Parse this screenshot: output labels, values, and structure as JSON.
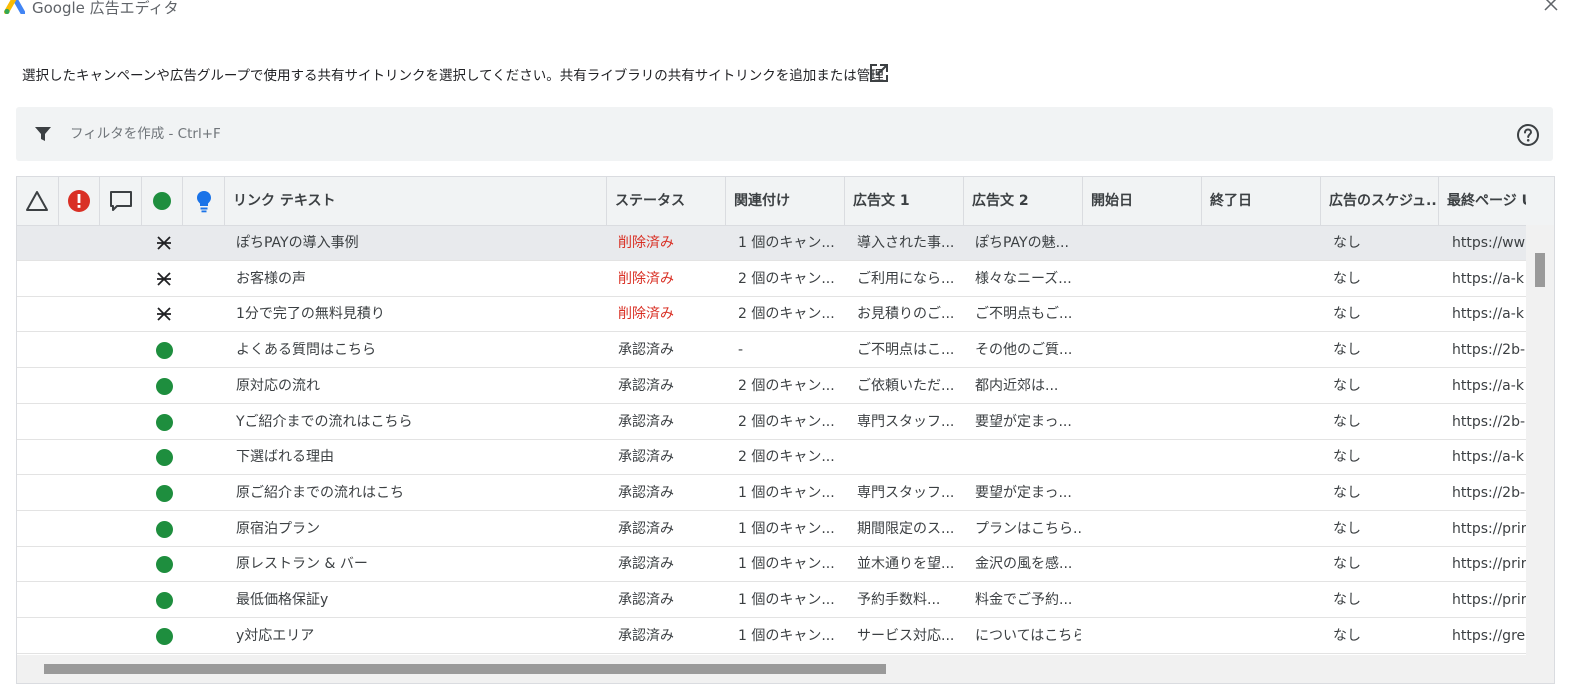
{
  "app_title": "Google 広告エディタ",
  "instruction": "選択したキャンペーンや広告グループで使用する共有サイトリンクを選択してください。共有ライブラリの共有サイトリンクを追加または管理",
  "filter": {
    "placeholder": "フィルタを作成 - Ctrl+F"
  },
  "colors": {
    "green": "#1e8e3e",
    "red": "#d93025",
    "blue": "#1a73e8",
    "error_red": "#d93025"
  },
  "header_icons": [
    "warning-triangle-icon",
    "error-icon",
    "comment-icon",
    "status-dot-icon",
    "lightbulb-icon"
  ],
  "columns": {
    "link_text": "リンク テキスト",
    "status": "ステータス",
    "association": "関連付け",
    "desc1": "広告文 1",
    "desc2": "広告文 2",
    "start": "開始日",
    "end": "終了日",
    "schedule": "広告のスケジュ...",
    "final_url": "最終ページ U"
  },
  "rows": [
    {
      "state": "deleted",
      "link_text": "ぽちPAYの導入事例",
      "status": "削除済み",
      "association": "1 個のキャン...",
      "desc1": "導入された事...",
      "desc2": "ぽちPAYの魅...",
      "start": "",
      "end": "",
      "schedule": "なし",
      "final_url": "https://ww"
    },
    {
      "state": "deleted",
      "link_text": "お客様の声",
      "status": "削除済み",
      "association": "2 個のキャン...",
      "desc1": "ご利用になら...",
      "desc2": "様々なニーズ...",
      "start": "",
      "end": "",
      "schedule": "なし",
      "final_url": "https://a-k"
    },
    {
      "state": "deleted",
      "link_text": "1分で完了の無料見積り",
      "status": "削除済み",
      "association": "2 個のキャン...",
      "desc1": "お見積りのご...",
      "desc2": "ご不明点もご...",
      "start": "",
      "end": "",
      "schedule": "なし",
      "final_url": "https://a-k"
    },
    {
      "state": "approved",
      "link_text": "よくある質問はこちら",
      "status": "承認済み",
      "association": "-",
      "desc1": "ご不明点はこ...",
      "desc2": "その他のご質...",
      "start": "",
      "end": "",
      "schedule": "なし",
      "final_url": "https://2b-"
    },
    {
      "state": "approved",
      "link_text": "原対応の流れ",
      "status": "承認済み",
      "association": "2 個のキャン...",
      "desc1": "ご依頼いただ...",
      "desc2": "都内近郊は...",
      "start": "",
      "end": "",
      "schedule": "なし",
      "final_url": "https://a-k"
    },
    {
      "state": "approved",
      "link_text": "Yご紹介までの流れはこちら",
      "status": "承認済み",
      "association": "2 個のキャン...",
      "desc1": "専門スタッフ...",
      "desc2": "要望が定まっ...",
      "start": "",
      "end": "",
      "schedule": "なし",
      "final_url": "https://2b-"
    },
    {
      "state": "approved",
      "link_text": "下選ばれる理由",
      "status": "承認済み",
      "association": "2 個のキャン...",
      "desc1": "",
      "desc2": "",
      "start": "",
      "end": "",
      "schedule": "なし",
      "final_url": "https://a-k"
    },
    {
      "state": "approved",
      "link_text": "原ご紹介までの流れはこち",
      "status": "承認済み",
      "association": "1 個のキャン...",
      "desc1": "専門スタッフ...",
      "desc2": "要望が定まっ...",
      "start": "",
      "end": "",
      "schedule": "なし",
      "final_url": "https://2b-"
    },
    {
      "state": "approved",
      "link_text": "原宿泊プラン",
      "status": "承認済み",
      "association": "1 個のキャン...",
      "desc1": "期間限定のス...",
      "desc2": "プランはこちら...",
      "start": "",
      "end": "",
      "schedule": "なし",
      "final_url": "https://prir"
    },
    {
      "state": "approved",
      "link_text": "原レストラン & バー",
      "status": "承認済み",
      "association": "1 個のキャン...",
      "desc1": "並木通りを望...",
      "desc2": "金沢の風を感...",
      "start": "",
      "end": "",
      "schedule": "なし",
      "final_url": "https://prir"
    },
    {
      "state": "approved",
      "link_text": "最低価格保証y",
      "status": "承認済み",
      "association": "1 個のキャン...",
      "desc1": "予約手数料...",
      "desc2": "料金でご予約...",
      "start": "",
      "end": "",
      "schedule": "なし",
      "final_url": "https://prir"
    },
    {
      "state": "approved",
      "link_text": "y対応エリア",
      "status": "承認済み",
      "association": "1 個のキャン...",
      "desc1": "サービス対応...",
      "desc2": "についてはこちら",
      "start": "",
      "end": "",
      "schedule": "なし",
      "final_url": "https://gre"
    }
  ]
}
